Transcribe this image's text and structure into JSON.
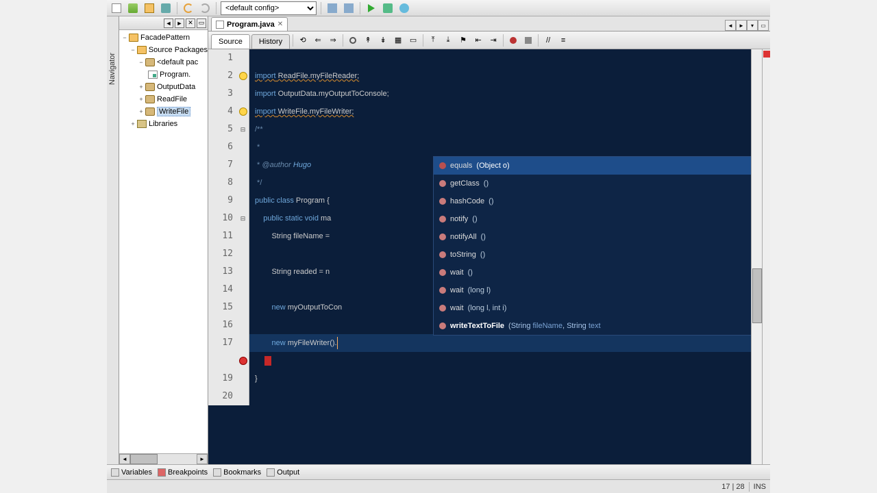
{
  "toolbar": {
    "config_selected": "<default config>"
  },
  "sidebar_collapsed_label": "Navigator",
  "project_tree": {
    "root": "FacadePattern",
    "source_packages": "Source Packages",
    "default_package": "<default pac",
    "program_file": "Program.",
    "output_data": "OutputData",
    "read_file": "ReadFile",
    "write_file": "WriteFile",
    "libraries": "Libraries"
  },
  "editor": {
    "tab_label": "Program.java",
    "view_source": "Source",
    "view_history": "History",
    "lines": {
      "2": {
        "pre": "import",
        "mid": " ReadFile.myFileReader;"
      },
      "3": {
        "pre": "import",
        "mid": " OutputData.myOutputToConsole;"
      },
      "4": {
        "pre": "import",
        "mid": " WriteFile.myFileWriter;"
      },
      "5": "/**",
      "6": " *",
      "7_pre": " * ",
      "7_anno": "@author",
      "7_auth": " Hugo",
      "8": " */",
      "9_pre": "public class",
      "9_name": " Program {",
      "10_pre": "    public static void",
      "10_rest": " ma",
      "11_pre": "        String fileName =",
      "13_pre": "        String readed = n",
      "15_pre": "        ",
      "15_kw": "new",
      "15_rest": " myOutputToCon",
      "17_pre": "        ",
      "17_kw": "new",
      "17_rest": " myFileWriter().",
      "19": "}"
    }
  },
  "autocomplete": [
    {
      "sel": true,
      "name": "equals",
      "sig": "(Object o)"
    },
    {
      "sel": false,
      "name": "getClass",
      "sig": "()"
    },
    {
      "sel": false,
      "name": "hashCode",
      "sig": "()"
    },
    {
      "sel": false,
      "name": "notify",
      "sig": "()"
    },
    {
      "sel": false,
      "name": "notifyAll",
      "sig": "()"
    },
    {
      "sel": false,
      "name": "toString",
      "sig": "()"
    },
    {
      "sel": false,
      "name": "wait",
      "sig": "()"
    },
    {
      "sel": false,
      "name": "wait",
      "sig": "(long l)"
    },
    {
      "sel": false,
      "name": "wait",
      "sig": "(long l, int i)"
    },
    {
      "sel": false,
      "name_bold": "writeTextToFile",
      "sig_rich": "(String fileName, String text"
    }
  ],
  "bottom_panels": {
    "variables": "Variables",
    "breakpoints": "Breakpoints",
    "bookmarks": "Bookmarks",
    "output": "Output"
  },
  "status": {
    "pos": "17 | 28",
    "ins": "INS"
  }
}
